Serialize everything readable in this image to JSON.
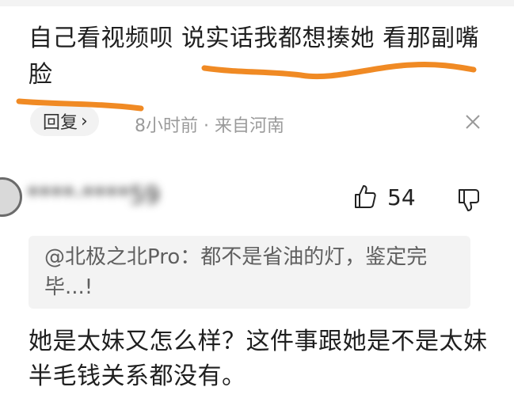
{
  "comment1": {
    "text": "自己看视频呗 说实话我都想揍她 看那副嘴脸",
    "reply_label": "回复",
    "reply_chevron": "›",
    "time": "8小时前",
    "separator": "·",
    "location": "来自河南",
    "close_icon": "close-icon"
  },
  "comment2": {
    "username": "****·****59",
    "likes": "54",
    "quote": "@北极之北Pro：都不是省油的灯，鉴定完毕...!",
    "text": "她是太妹又怎么样？这件事跟她是不是太妹半毛钱关系都没有。"
  },
  "colors": {
    "annotation_orange": "#f08a24",
    "meta_gray": "#9a9a9a",
    "quote_bg": "#f3f3f3"
  }
}
